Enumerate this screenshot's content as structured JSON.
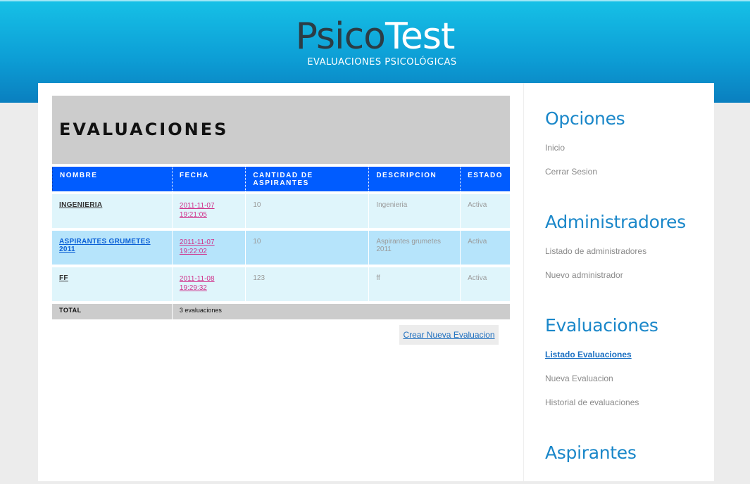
{
  "header": {
    "logo_part1": "Psico",
    "logo_part2": "Test",
    "tagline": "EVALUACIONES PSICOLÓGICAS"
  },
  "main": {
    "title": "EVALUACIONES",
    "columns": [
      "NOMBRE",
      "FECHA",
      "CANTIDAD DE ASPIRANTES",
      "DESCRIPCION",
      "ESTADO"
    ],
    "rows": [
      {
        "nombre": "INGENIERIA",
        "fecha_date": "2011-11-07",
        "fecha_time": "19:21:05",
        "cantidad": "10",
        "descripcion": "Ingenieria",
        "estado": "Activa"
      },
      {
        "nombre": "ASPIRANTES GRUMETES 2011",
        "fecha_date": "2011-11-07",
        "fecha_time": "19:22:02",
        "cantidad": "10",
        "descripcion": "Aspirantes grumetes 2011",
        "estado": "Activa"
      },
      {
        "nombre": "FF",
        "fecha_date": "2011-11-08",
        "fecha_time": "19:29:32",
        "cantidad": "123",
        "descripcion": "ff",
        "estado": "Activa"
      }
    ],
    "total_label": "TOTAL",
    "total_value": "3 evaluaciones",
    "create_button": "Crear Nueva Evaluacion"
  },
  "sidebar": {
    "sections": [
      {
        "title": "Opciones",
        "items": [
          "Inicio",
          "Cerrar Sesion"
        ]
      },
      {
        "title": "Administradores",
        "items": [
          "Listado de administradores",
          "Nuevo administrador"
        ]
      },
      {
        "title": "Evaluaciones",
        "items": [
          "Listado Evaluaciones",
          "Nueva Evaluacion",
          "Historial de evaluaciones"
        ],
        "active_item": "Listado Evaluaciones"
      },
      {
        "title": "Aspirantes",
        "items": []
      }
    ]
  },
  "colors": {
    "header_accent": "#0d9fd6",
    "table_header": "#005cff",
    "row_light": "#dff5fb",
    "row_highlight": "#b6e4fb",
    "sidebar_title": "#1a87c9",
    "date_link": "#d0308a"
  }
}
